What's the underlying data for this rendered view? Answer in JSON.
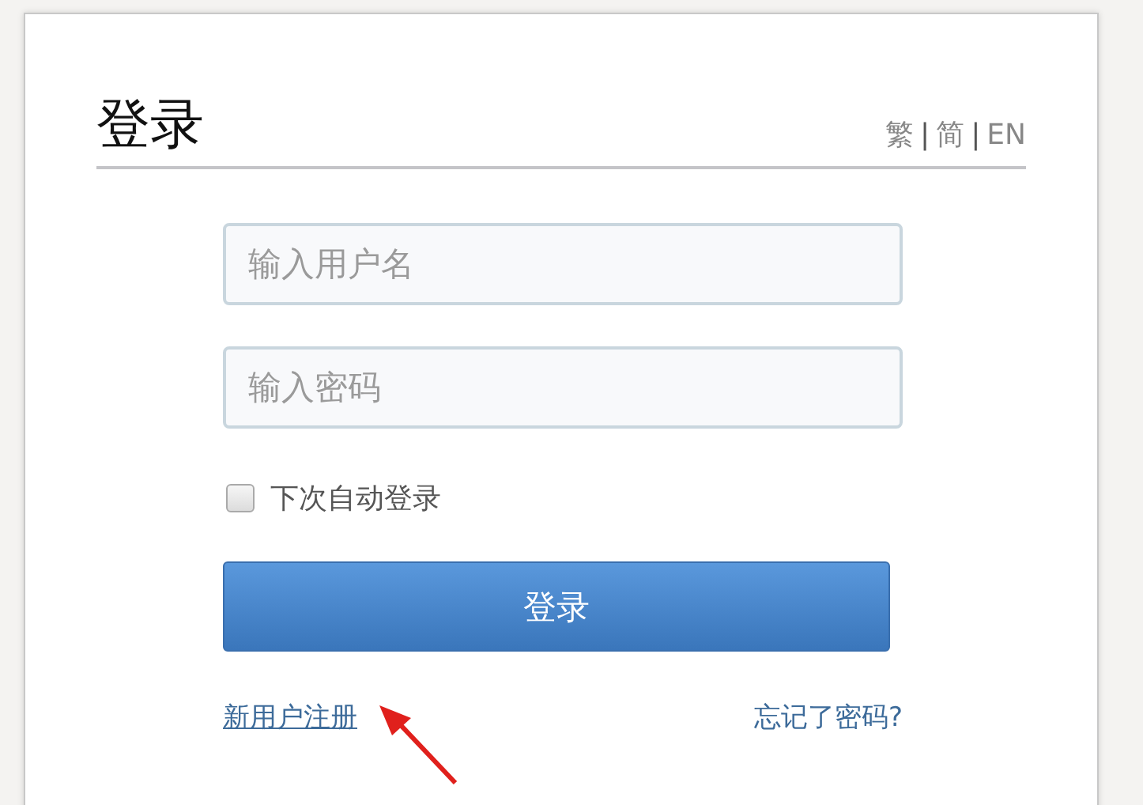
{
  "title": "登录",
  "languages": [
    {
      "kind": "link",
      "label": "繁"
    },
    {
      "kind": "separator",
      "label": "|"
    },
    {
      "kind": "link",
      "label": "简"
    },
    {
      "kind": "separator",
      "label": "|"
    },
    {
      "kind": "link",
      "label": "EN"
    }
  ],
  "username": {
    "placeholder": "输入用户名"
  },
  "password": {
    "placeholder": "输入密码"
  },
  "remember": {
    "label": "下次自动登录",
    "checked": false
  },
  "login_button": "登录",
  "register_link": "新用户注册",
  "forgot_link": "忘记了密码?"
}
